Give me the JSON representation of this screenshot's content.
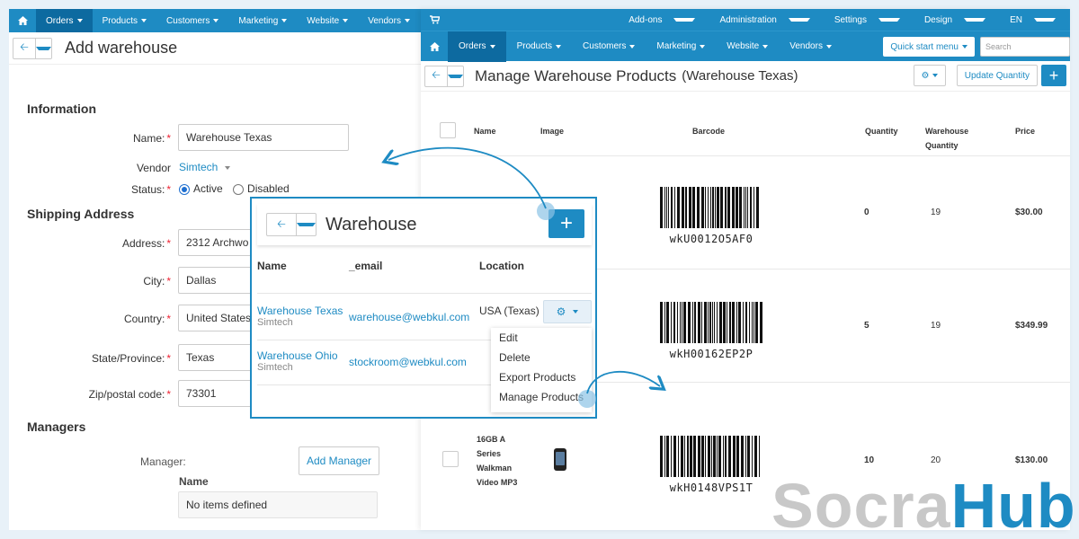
{
  "left": {
    "nav": {
      "items": [
        "Orders",
        "Products",
        "Customers",
        "Marketing",
        "Website",
        "Vendors"
      ]
    },
    "page_title": "Add warehouse",
    "information": {
      "heading": "Information",
      "name_label": "Name:",
      "name_value": "Warehouse Texas",
      "vendor_label": "Vendor",
      "vendor_value": "Simtech",
      "status_label": "Status:",
      "status_active": "Active",
      "status_disabled": "Disabled"
    },
    "shipping": {
      "heading": "Shipping Address",
      "address_label": "Address:",
      "address_value": "2312 Archwo",
      "city_label": "City:",
      "city_value": "Dallas",
      "country_label": "Country:",
      "country_value": "United States",
      "state_label": "State/Province:",
      "state_value": "Texas",
      "zip_label": "Zip/postal code:",
      "zip_value": "73301"
    },
    "managers": {
      "heading": "Managers",
      "manager_label": "Manager:",
      "add_button": "Add Manager",
      "name_col": "Name",
      "empty_text": "No items defined"
    }
  },
  "right": {
    "top_bar": [
      "Add-ons",
      "Administration",
      "Settings",
      "Design",
      "EN"
    ],
    "nav": {
      "items": [
        "Orders",
        "Products",
        "Customers",
        "Marketing",
        "Website",
        "Vendors"
      ]
    },
    "quick_start": "Quick start menu",
    "search_placeholder": "Search",
    "page_title": "Manage Warehouse Products",
    "page_subtitle": "(Warehouse Texas)",
    "update_button": "Update Quantity",
    "columns": {
      "name": "Name",
      "image": "Image",
      "barcode": "Barcode",
      "quantity": "Quantity",
      "warehouse_quantity_1": "Warehouse",
      "warehouse_quantity_2": "Quantity",
      "price": "Price"
    },
    "rows": [
      {
        "barcode": "wkU0012O5AF0",
        "quantity": "0",
        "warehouse_quantity": "19",
        "price": "$30.00"
      },
      {
        "barcode": "wkH00162EP2P",
        "quantity": "5",
        "warehouse_quantity": "19",
        "price": "$349.99"
      },
      {
        "name_1": "16GB A",
        "name_2": "Series",
        "name_3": "Walkman",
        "name_4": "Video MP3",
        "barcode": "wkH0148VPS1T",
        "quantity": "10",
        "warehouse_quantity": "20",
        "price": "$130.00"
      }
    ]
  },
  "popup": {
    "title": "Warehouse",
    "columns": {
      "name": "Name",
      "email": "_email",
      "location": "Location"
    },
    "rows": [
      {
        "name": "Warehouse Texas",
        "vendor": "Simtech",
        "email": "warehouse@webkul.com",
        "location": "USA (Texas)"
      },
      {
        "name": "Warehouse Ohio",
        "vendor": "Simtech",
        "email": "stockroom@webkul.com"
      }
    ],
    "menu": [
      "Edit",
      "Delete",
      "Export Products",
      "Manage Products"
    ]
  },
  "logo": {
    "part1": "Socra",
    "part2": "Hub"
  },
  "colors": {
    "accent": "#1e8bc3",
    "nav_active": "#0d6aa0",
    "background": "#e8f1f8"
  }
}
